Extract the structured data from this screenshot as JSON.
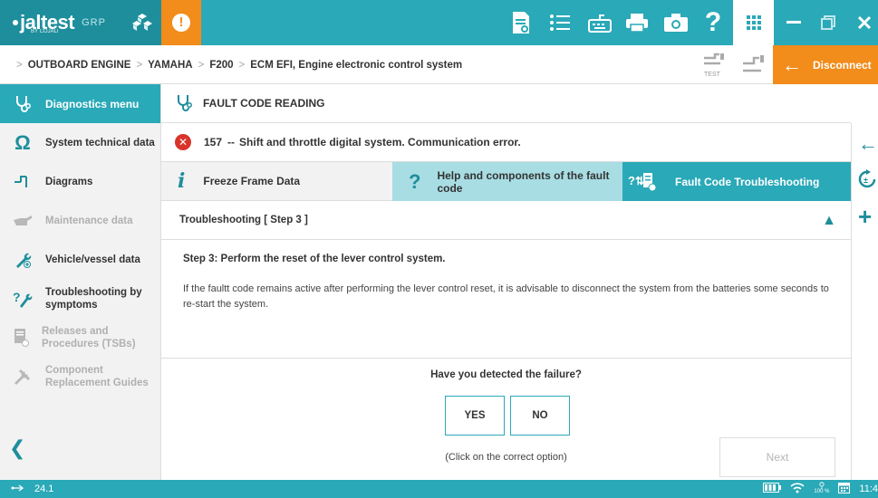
{
  "app": {
    "logo_text": "jaltest",
    "logo_sub": "BY COJALI",
    "logo_grp": "GRP"
  },
  "toolbar": {
    "icons": [
      "report-icon",
      "list-icon",
      "keyboard-icon",
      "printer-icon",
      "camera-icon",
      "help-icon",
      "apps-grid-icon",
      "minimize-icon",
      "restore-icon",
      "close-icon"
    ],
    "help_label": "?"
  },
  "breadcrumb": {
    "items": [
      "OUTBOARD ENGINE",
      "YAMAHA",
      "F200",
      "ECM EFI, Engine electronic control system"
    ],
    "test_label": "TEST",
    "disconnect_label": "Disconnect"
  },
  "sidebar": {
    "header": "Diagnostics menu",
    "items": [
      {
        "label": "System technical data",
        "enabled": true
      },
      {
        "label": "Diagrams",
        "enabled": true
      },
      {
        "label": "Maintenance data",
        "enabled": false
      },
      {
        "label": "Vehicle/vessel data",
        "enabled": true
      },
      {
        "label": "Troubleshooting by symptoms",
        "enabled": true
      },
      {
        "label": "Releases and Procedures (TSBs)",
        "enabled": false
      },
      {
        "label": "Component Replacement Guides",
        "enabled": false
      }
    ]
  },
  "main": {
    "section_title": "FAULT CODE READING",
    "error": {
      "code": "157",
      "sep": "--",
      "message": "Shift and throttle digital system. Communication error."
    },
    "tabs": [
      {
        "label": "Freeze Frame Data",
        "active": false
      },
      {
        "label": "Help and components of the fault code",
        "active": false
      },
      {
        "label": "Fault Code Troubleshooting",
        "active": true
      }
    ],
    "step_header": "Troubleshooting [ Step 3 ]",
    "step_title": "Step 3: Perform the reset of the lever control system.",
    "step_text": "If the faultt code remains active after performing the lever control reset, it is advisable to disconnect the system from the batteries some seconds to re-start the system.",
    "question": "Have you detected the failure?",
    "yes_label": "YES",
    "no_label": "NO",
    "hint": "(Click on the correct option)",
    "next_label": "Next"
  },
  "status": {
    "version": "24.1",
    "zoom": "100 %",
    "time": "11:4"
  },
  "colors": {
    "teal": "#2aa9b8",
    "dark_teal": "#1e8e9c",
    "orange": "#f28c1a",
    "light_teal": "#a8dde3",
    "error_red": "#d9342b"
  }
}
